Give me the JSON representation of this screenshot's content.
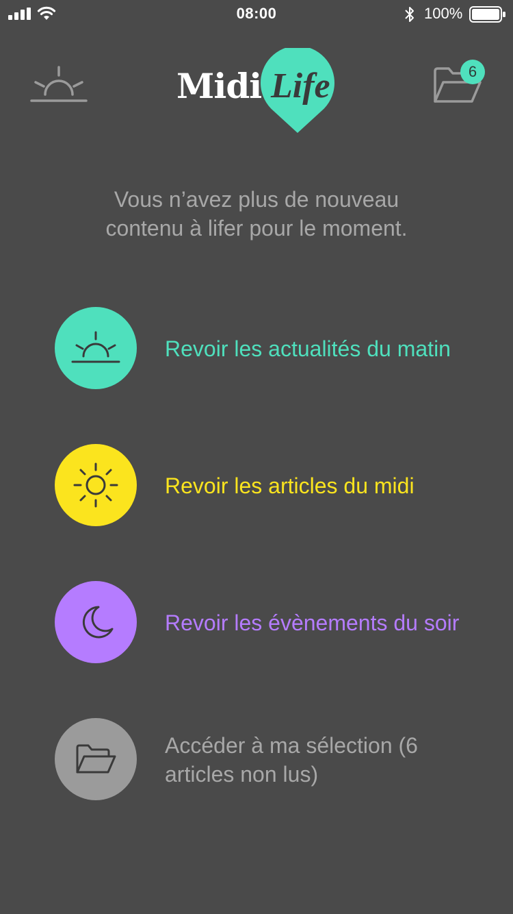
{
  "status_bar": {
    "time": "08:00",
    "battery": "100%"
  },
  "header": {
    "logo_word_1": "Midi",
    "logo_word_2": "Life",
    "badge_count": "6"
  },
  "message": {
    "line1": "Vous n’avez plus de nouveau",
    "line2": "contenu à lifer pour le moment."
  },
  "options": [
    {
      "label": "Revoir les actualités du matin",
      "icon": "sunrise-icon",
      "color": "#4fe0bd"
    },
    {
      "label": "Revoir les articles du midi",
      "icon": "sun-icon",
      "color": "#fbe41e"
    },
    {
      "label": "Revoir les évènements du soir",
      "icon": "moon-icon",
      "color": "#b57cff"
    },
    {
      "label": "Accéder à ma sélection (6 articles non lus)",
      "icon": "folder-open-icon",
      "color": "#9b9b9b"
    }
  ],
  "colors": {
    "background": "#4a4a4a",
    "accent": "#4fe0bd",
    "muted_text": "#a8a8a8"
  }
}
